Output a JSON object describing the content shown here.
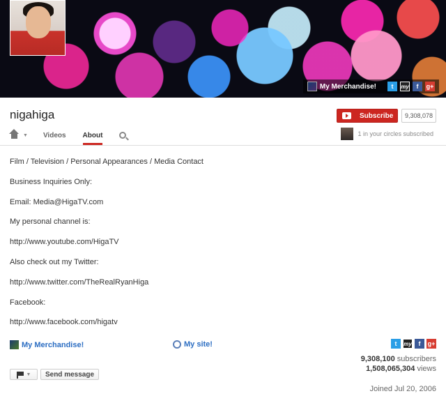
{
  "channel": {
    "name": "nigahiga",
    "subscribe_label": "Subscribe",
    "subscriber_count_badge": "9,308,078",
    "circles_text": "1 in your circles subscribed"
  },
  "banner": {
    "merch_label": "My Merchandise!"
  },
  "nav": {
    "tabs": [
      {
        "label": "Videos"
      },
      {
        "label": "About"
      }
    ],
    "active_tab": "About"
  },
  "about": {
    "lines": [
      "Film / Television / Personal Appearances / Media Contact",
      "Business Inquiries Only:",
      "Email: Media@HigaTV.com",
      "My personal channel is:",
      "http://www.youtube.com/HigaTV",
      "Also check out my Twitter:",
      "http://www.twitter.com/TheRealRyanHiga",
      "Facebook:",
      "http://www.facebook.com/higatv"
    ],
    "links": {
      "merch": "My Merchandise!",
      "site": "My site!"
    }
  },
  "stats": {
    "subscribers_value": "9,308,100",
    "subscribers_label": "subscribers",
    "views_value": "1,508,065,304",
    "views_label": "views",
    "joined": "Joined Jul 20, 2006"
  },
  "actions": {
    "send_message": "Send message"
  },
  "social_icons": {
    "twitter": "t",
    "myspace": "my",
    "facebook": "f",
    "googleplus": "g+"
  },
  "colors": {
    "accent_red": "#cc2620",
    "link_blue": "#2b6dc2"
  }
}
